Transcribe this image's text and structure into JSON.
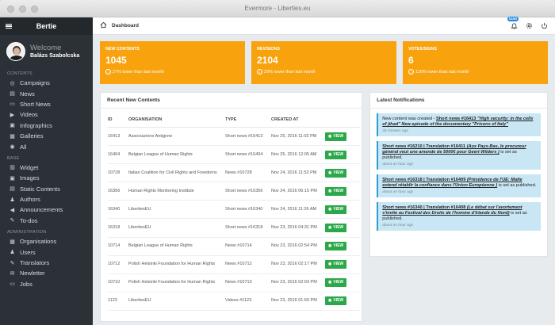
{
  "window": {
    "title": "Evermore - Liberties.eu"
  },
  "sidebar": {
    "brand": "Bertie",
    "profile": {
      "welcome": "Welcome",
      "name": "Balázs Szabolcska"
    },
    "sections": [
      {
        "title": "Contents",
        "items": [
          {
            "label": "Campaigns",
            "icon": "target-icon"
          },
          {
            "label": "News",
            "icon": "newspaper-icon"
          },
          {
            "label": "Short News",
            "icon": "short-news-icon"
          },
          {
            "label": "Videos",
            "icon": "video-icon"
          },
          {
            "label": "Infographics",
            "icon": "image-icon"
          },
          {
            "label": "Galleries",
            "icon": "gallery-icon"
          },
          {
            "label": "All",
            "icon": "all-icon"
          }
        ]
      },
      {
        "title": "Base",
        "items": [
          {
            "label": "Widget",
            "icon": "widget-icon"
          },
          {
            "label": "Images",
            "icon": "images-icon"
          },
          {
            "label": "Static Contents",
            "icon": "static-contents-icon"
          },
          {
            "label": "Authors",
            "icon": "authors-icon"
          },
          {
            "label": "Announcements",
            "icon": "megaphone-icon"
          },
          {
            "label": "To-dos",
            "icon": "todo-icon"
          }
        ]
      },
      {
        "title": "Administration",
        "items": [
          {
            "label": "Organisations",
            "icon": "organisations-icon"
          },
          {
            "label": "Users",
            "icon": "users-icon"
          },
          {
            "label": "Translators",
            "icon": "translators-icon"
          },
          {
            "label": "Newletter",
            "icon": "newsletter-icon"
          },
          {
            "label": "Jobs",
            "icon": "jobs-icon"
          }
        ]
      }
    ]
  },
  "header": {
    "breadcrumb": "Dashboard",
    "notification_count": "5150"
  },
  "stats": [
    {
      "label": "New contents",
      "value": "1045",
      "change": "27% lower",
      "suffix": "than last month"
    },
    {
      "label": "Revisions",
      "value": "2104",
      "change": "29% lower",
      "suffix": "than last month"
    },
    {
      "label": "Votes/signs",
      "value": "6",
      "change": "116% lower",
      "suffix": "than last month"
    }
  ],
  "recent": {
    "title": "Recent New Contents",
    "columns": [
      "ID",
      "ORGANISATION",
      "TYPE",
      "CREATED AT",
      ""
    ],
    "view_label": "VIEW",
    "rows": [
      {
        "id": "16413",
        "org": "Associazione Antigone",
        "type": "Short news #16413",
        "created": "Nov 25, 2016 11:02 PM"
      },
      {
        "id": "16404",
        "org": "Belgian League of Human Rights",
        "type": "Short news #16404",
        "created": "Nov 25, 2016 12:05 AM"
      },
      {
        "id": "10728",
        "org": "Italian Coalition for Civil Rights and Freedoms",
        "type": "News #10728",
        "created": "Nov 24, 2016 11:53 PM"
      },
      {
        "id": "16356",
        "org": "Human Rights Monitoring Institute",
        "type": "Short news #16356",
        "created": "Nov 24, 2016 06:15 PM"
      },
      {
        "id": "16340",
        "org": "LibertiesEU",
        "type": "Short news #16340",
        "created": "Nov 24, 2016 11:26 AM"
      },
      {
        "id": "16318",
        "org": "LibertiesEU",
        "type": "Short news #16318",
        "created": "Nov 23, 2016 04:31 PM"
      },
      {
        "id": "10714",
        "org": "Belgian League of Human Rights",
        "type": "News #10714",
        "created": "Nov 23, 2016 02:54 PM"
      },
      {
        "id": "10712",
        "org": "Polish Helsinki Foundation for Human Rights",
        "type": "News #10712",
        "created": "Nov 23, 2016 02:17 PM"
      },
      {
        "id": "10710",
        "org": "Polish Helsinki Foundation for Human Rights",
        "type": "News #10710",
        "created": "Nov 23, 2016 02:03 PM"
      },
      {
        "id": "1123",
        "org": "LibertiesEU",
        "type": "Videos #1123",
        "created": "Nov 23, 2016 01:50 PM"
      }
    ]
  },
  "notifications": {
    "title": "Latest Notifications",
    "items": [
      {
        "prefix": "New content was created - ",
        "link": "Short news #16413 ",
        "link_italic": "\"High security: in the cells of jihad\" New episode of the documentary \"Prisons of Italy\"",
        "suffix": "",
        "time": "36 minutes ago"
      },
      {
        "prefix": "",
        "link": "Short news #16210 | Translation #16411 ",
        "link_italic": "(Aux Pays-Bas, le procureur général veut une amende de 5000€ pour Geert Wilders )",
        "suffix": " is set as published.",
        "time": "about an hour ago"
      },
      {
        "prefix": "",
        "link": "Short news #16318 | Translation #16409 ",
        "link_italic": "(Présidence de l'UE: Malte entend rétablir la confiance dans l'Union Européenne )",
        "suffix": " is set as published.",
        "time": "about an hour ago"
      },
      {
        "prefix": "",
        "link": "Short news #16340 | Translation #16408 ",
        "link_italic": "(Le débat sur l'avortement s'invite au Festival des Droits de l'homme d'Irlande du Nord)",
        "suffix": " is set as published.",
        "time": "about an hour ago"
      }
    ]
  },
  "colors": {
    "accent": "#f8a20e",
    "sidebar": "#2b3136",
    "view_button": "#2ba84a",
    "notification_bg": "#c8e6f4"
  }
}
